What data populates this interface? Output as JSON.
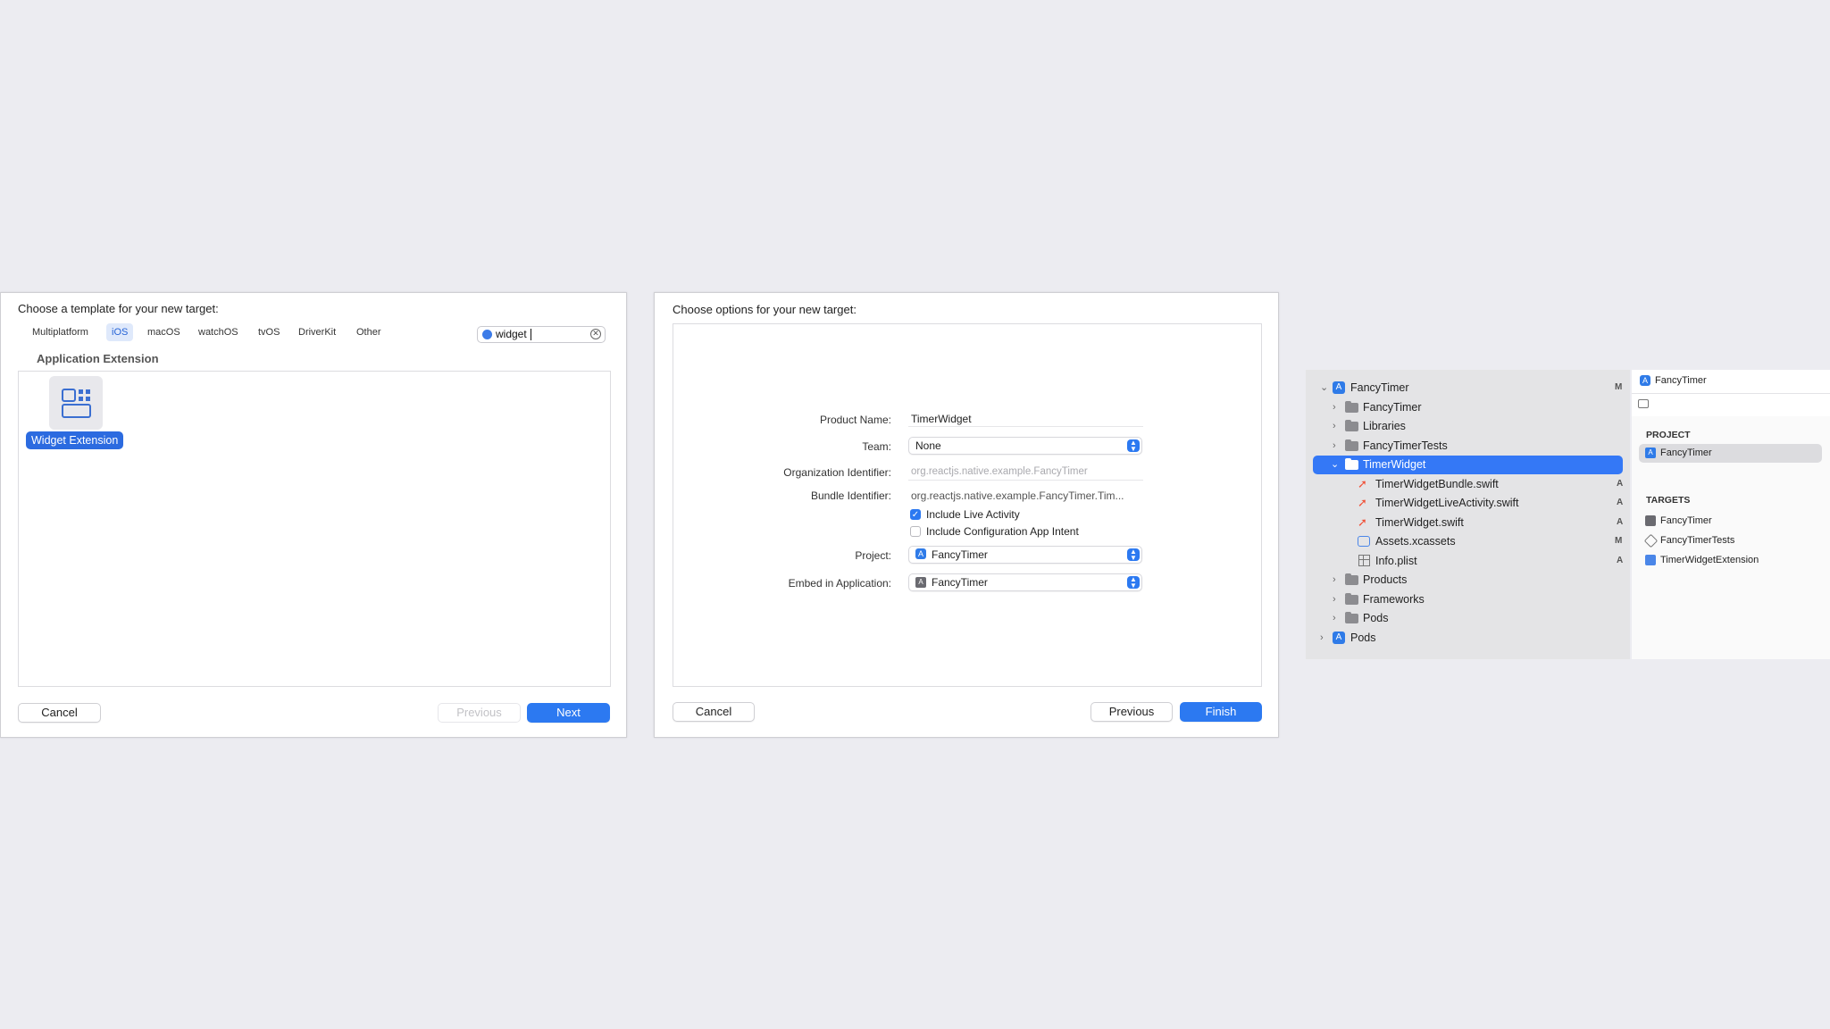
{
  "dialog1": {
    "title": "Choose a template for your new target:",
    "tabs": [
      {
        "label": "Multiplatform",
        "active": false
      },
      {
        "label": "iOS",
        "active": true
      },
      {
        "label": "macOS",
        "active": false
      },
      {
        "label": "watchOS",
        "active": false
      },
      {
        "label": "tvOS",
        "active": false
      },
      {
        "label": "DriverKit",
        "active": false
      },
      {
        "label": "Other",
        "active": false
      }
    ],
    "search": {
      "value": "widget"
    },
    "section_header": "Application Extension",
    "template": {
      "label": "Widget Extension",
      "selected": true
    },
    "cancel_label": "Cancel",
    "previous_label": "Previous",
    "next_label": "Next"
  },
  "dialog2": {
    "title": "Choose options for your new target:",
    "fields": {
      "product_name": {
        "label": "Product Name:",
        "value": "TimerWidget"
      },
      "team": {
        "label": "Team:",
        "value": "None"
      },
      "org_identifier": {
        "label": "Organization Identifier:",
        "placeholder": "org.reactjs.native.example.FancyTimer"
      },
      "bundle_identifier": {
        "label": "Bundle Identifier:",
        "value": "org.reactjs.native.example.FancyTimer.Tim..."
      },
      "include_live_activity": {
        "label": "Include Live Activity",
        "checked": true
      },
      "include_config_intent": {
        "label": "Include Configuration App Intent",
        "checked": false
      },
      "project": {
        "label": "Project:",
        "value": "FancyTimer"
      },
      "embed_in_application": {
        "label": "Embed in Application:",
        "value": "FancyTimer"
      }
    },
    "cancel_label": "Cancel",
    "previous_label": "Previous",
    "finish_label": "Finish"
  },
  "navigator": {
    "items": [
      {
        "label": "FancyTimer",
        "status": "M",
        "kind": "project",
        "expanded": true
      },
      {
        "label": "FancyTimer",
        "status": "",
        "kind": "folder",
        "expanded": false
      },
      {
        "label": "Libraries",
        "status": "",
        "kind": "folder",
        "expanded": false
      },
      {
        "label": "FancyTimerTests",
        "status": "",
        "kind": "folder",
        "expanded": false
      },
      {
        "label": "TimerWidget",
        "status": "",
        "kind": "folder",
        "expanded": true,
        "selected": true
      },
      {
        "label": "TimerWidgetBundle.swift",
        "status": "A",
        "kind": "swift"
      },
      {
        "label": "TimerWidgetLiveActivity.swift",
        "status": "A",
        "kind": "swift"
      },
      {
        "label": "TimerWidget.swift",
        "status": "A",
        "kind": "swift"
      },
      {
        "label": "Assets.xcassets",
        "status": "M",
        "kind": "assets"
      },
      {
        "label": "Info.plist",
        "status": "A",
        "kind": "plist"
      },
      {
        "label": "Products",
        "status": "",
        "kind": "folder",
        "expanded": false
      },
      {
        "label": "Frameworks",
        "status": "",
        "kind": "folder",
        "expanded": false
      },
      {
        "label": "Pods",
        "status": "",
        "kind": "folder",
        "expanded": false
      },
      {
        "label": "Pods",
        "status": "",
        "kind": "project",
        "expanded": false
      }
    ]
  },
  "editor": {
    "tab_label": "FancyTimer",
    "project_header": "PROJECT",
    "project_item": "FancyTimer",
    "targets_header": "TARGETS",
    "targets": [
      "FancyTimer",
      "FancyTimerTests",
      "TimerWidgetExtension"
    ]
  },
  "colors": {
    "accent": "#2c79f1",
    "selection": "#3478f6",
    "swift": "#f05138",
    "background": "#ececf1"
  }
}
